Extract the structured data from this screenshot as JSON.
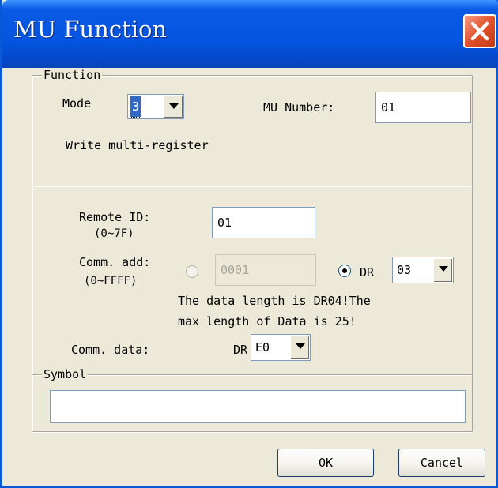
{
  "window": {
    "title": "MU Function",
    "close_icon": "close-icon"
  },
  "function_group": {
    "legend": "Function",
    "mode_label": "Mode",
    "mode_value": "3",
    "mu_number_label": "MU Number:",
    "mu_number_value": "01",
    "description": "Write multi-register"
  },
  "remote": {
    "remote_id_label": "Remote ID:",
    "remote_id_range": "(0~7F)",
    "remote_id_value": "01",
    "comm_add_label": "Comm. add:",
    "comm_add_range": "(0~FFFF)",
    "comm_add_value": "0001",
    "comm_add_radio_checked": false,
    "dr_radio_label": "DR",
    "dr_radio_checked": true,
    "dr_value": "03",
    "info_line1": "The data length is DR04!The",
    "info_line2": "max length of Data is 25!",
    "comm_data_label": "Comm. data:",
    "comm_data_prefix": "DR",
    "comm_data_value": "E0"
  },
  "symbol_group": {
    "legend": "Symbol",
    "value": ""
  },
  "buttons": {
    "ok_label": "OK",
    "cancel_label": "Cancel"
  },
  "colors": {
    "title_bar": "#0555e0",
    "dialog_bg": "#ece9d8",
    "close_button": "#e2512b",
    "selection": "#316ac5"
  }
}
